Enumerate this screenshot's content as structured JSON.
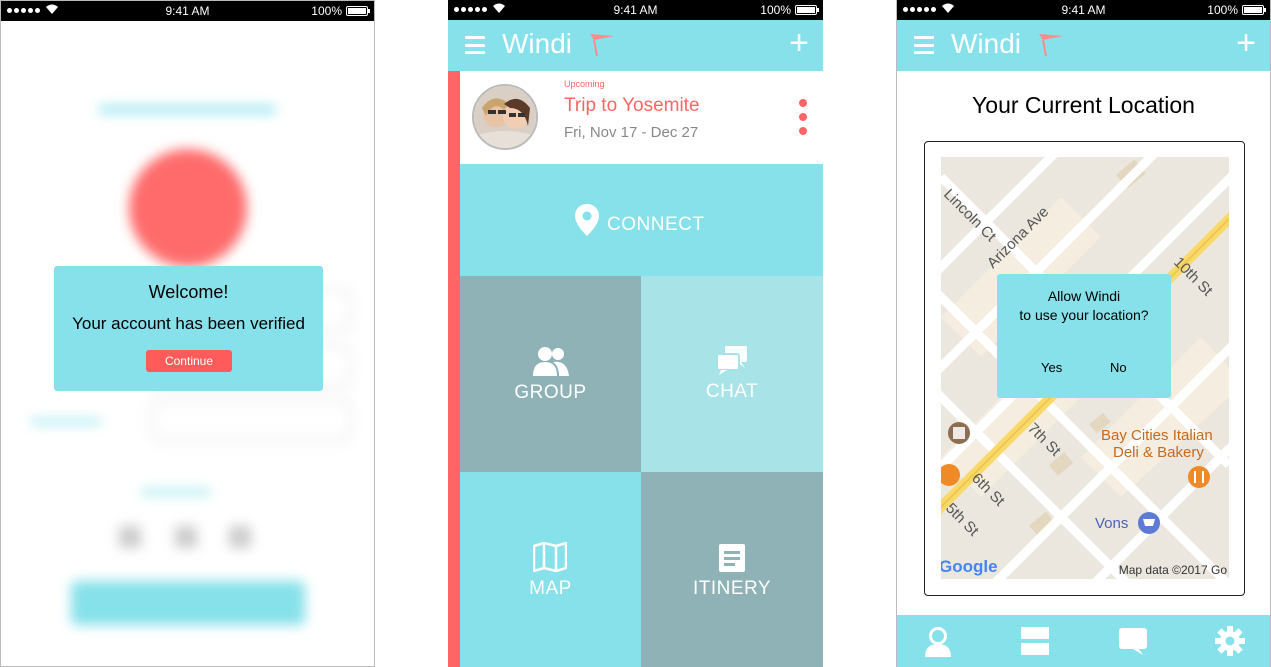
{
  "status_bar": {
    "time": "9:41 AM",
    "battery": "100%"
  },
  "screen1": {
    "dialog": {
      "title": "Welcome!",
      "message": "Your account has been verified",
      "button": "Continue"
    }
  },
  "app": {
    "brand": "Windi"
  },
  "screen2": {
    "trip": {
      "status": "Upcoming",
      "name": "Trip to Yosemite",
      "dates": "Fri, Nov 17 - Dec 27"
    },
    "tiles": {
      "connect": "CONNECT",
      "group": "GROUP",
      "chat": "CHAT",
      "map": "MAP",
      "itinerary": "ITINERY"
    }
  },
  "screen3": {
    "title": "Your Current Location",
    "dialog": {
      "line1": "Allow Windi",
      "line2": "to use your location?",
      "yes": "Yes",
      "no": "No"
    },
    "map": {
      "streets": [
        "Lincoln Ct",
        "Arizona Ave",
        "10th St",
        "7th St",
        "6th St",
        "5th St"
      ],
      "places": [
        "Bay Cities Italian",
        "Deli & Bakery",
        "Vons"
      ],
      "attribution": "Map data ©2017 Go",
      "logo": "Google"
    }
  },
  "colors": {
    "teal": "#86e1ea",
    "teal_dark": "#8eb2b5",
    "teal_light": "#a8e3e8",
    "coral": "#ff6565"
  }
}
